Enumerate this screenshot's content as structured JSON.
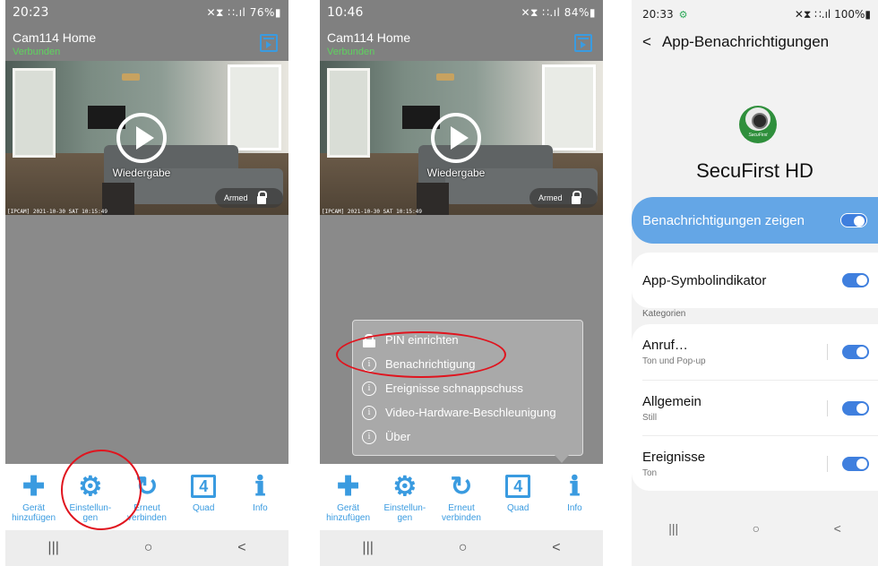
{
  "panel1": {
    "status_time": "20:23",
    "status_right": "✕⧗ ∷.ıl 76%▮",
    "title": "Cam114 Home",
    "connection": "Verbunden",
    "play_label": "Wiedergabe",
    "armed_label": "Armed",
    "osd_text": "[IPCAM] 2021-10-30 SAT 10:15:49",
    "toolbar": [
      {
        "icon": "plus-icon",
        "glyph": "✚",
        "label": "Gerät\nhinzufügen"
      },
      {
        "icon": "gear-icon",
        "glyph": "⚙",
        "label": "Einstellun-\ngen"
      },
      {
        "icon": "refresh-icon",
        "glyph": "↻",
        "label": "Erneut\nverbinden"
      },
      {
        "icon": "quad-icon",
        "glyph": "4",
        "label": "Quad"
      },
      {
        "icon": "info-icon",
        "glyph": "ℹ",
        "label": "Info"
      }
    ],
    "nav": [
      "|||",
      "○",
      "<"
    ]
  },
  "panel2": {
    "status_time": "10:46",
    "status_right": "✕⧗ ∷.ıl 84%▮",
    "title": "Cam114 Home",
    "connection": "Verbunden",
    "play_label": "Wiedergabe",
    "armed_label": "Armed",
    "osd_text": "[IPCAM] 2021-10-30 SAT 10:15:49",
    "menu": [
      {
        "icon": "lock-icon",
        "label": "PIN einrichten"
      },
      {
        "icon": "info-circle-icon",
        "label": "Benachrichtigung"
      },
      {
        "icon": "info-circle-icon",
        "label": "Ereignisse schnappschuss"
      },
      {
        "icon": "info-circle-icon",
        "label": "Video-Hardware-Beschleunigung"
      },
      {
        "icon": "info-circle-icon",
        "label": "Über"
      }
    ],
    "toolbar": [
      {
        "icon": "plus-icon",
        "glyph": "✚",
        "label": "Gerät\nhinzufügen"
      },
      {
        "icon": "gear-icon",
        "glyph": "⚙",
        "label": "Einstellun-\ngen"
      },
      {
        "icon": "refresh-icon",
        "glyph": "↻",
        "label": "Erneut\nverbinden"
      },
      {
        "icon": "quad-icon",
        "glyph": "4",
        "label": "Quad"
      },
      {
        "icon": "info-icon",
        "glyph": "ℹ",
        "label": "Info"
      }
    ],
    "nav": [
      "|||",
      "○",
      "<"
    ]
  },
  "panel3": {
    "status_time": "20:33",
    "status_right": "✕⧗ ∷.ıl 100%▮",
    "back": "<",
    "title": "App-Benachrichtigungen",
    "app_brand": "SecuFirst",
    "app_name": "SecuFirst HD",
    "main_toggle": {
      "label": "Benachrichtigungen zeigen",
      "on": true
    },
    "badge_row": {
      "label": "App-Symbolindikator",
      "on": true
    },
    "categories_header": "Kategorien",
    "categories": [
      {
        "label": "Anruf…",
        "sub": "Ton und Pop-up",
        "on": true
      },
      {
        "label": "Allgemein",
        "sub": "Still",
        "on": true
      },
      {
        "label": "Ereignisse",
        "sub": "Ton",
        "on": true
      }
    ],
    "nav": [
      "|||",
      "○",
      "<"
    ]
  },
  "colors": {
    "accent": "#3a9be0",
    "connected": "#5ed25e",
    "highlight": "#e0141e",
    "toggle": "#3f7fde",
    "main_row": "#64a6e6"
  }
}
